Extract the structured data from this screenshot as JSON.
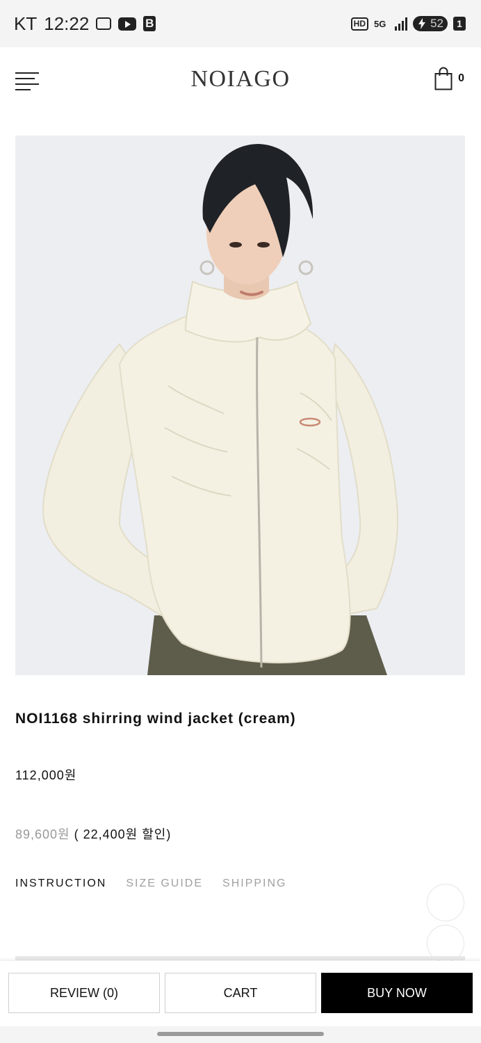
{
  "status_bar": {
    "carrier": "KT",
    "time": "12:22",
    "battery": "52",
    "sim": "1",
    "network": "5G",
    "hd": "HD",
    "b_icon": "B"
  },
  "header": {
    "brand": "NOIAGO",
    "cart_count": "0"
  },
  "product": {
    "name": "NOI1168 shirring wind jacket (cream)",
    "price": "112,000원",
    "sale_price": "89,600원",
    "discount_text": " ( 22,400원 할인)"
  },
  "tabs": [
    {
      "label": "INSTRUCTION",
      "active": true
    },
    {
      "label": "SIZE GUIDE",
      "active": false
    },
    {
      "label": "SHIPPING",
      "active": false
    }
  ],
  "actions": {
    "review": "REVIEW (0)",
    "cart": "CART",
    "buy_now": "BUY NOW"
  },
  "colors": {
    "brand_text": "#333333",
    "buy_button": "#000000",
    "sale_price": "#999999",
    "jacket": "#f4f1e3",
    "background_photo": "#eceef2"
  }
}
